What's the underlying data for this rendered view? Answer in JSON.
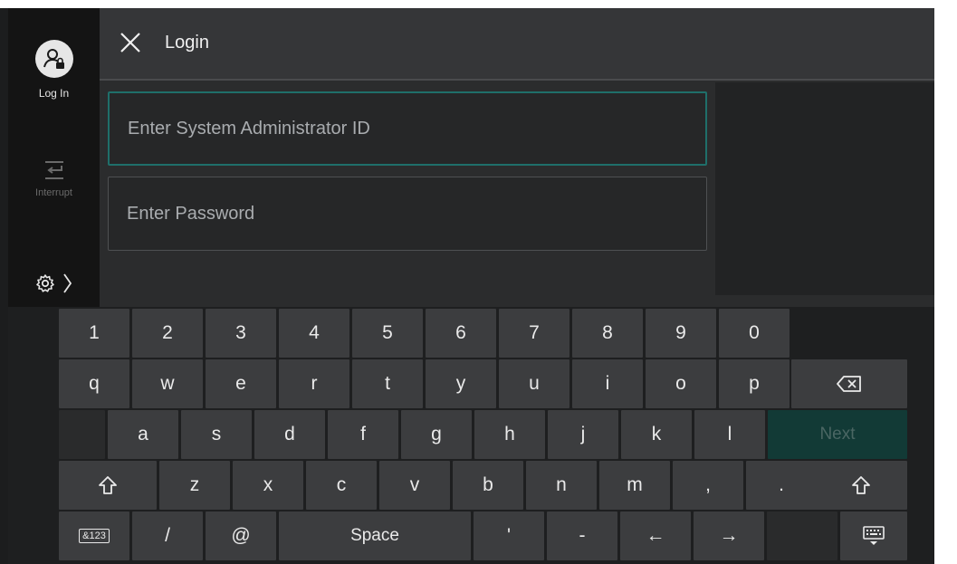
{
  "header": {
    "title": "Login"
  },
  "sidebar": {
    "login_label": "Log In",
    "interrupt_label": "Interrupt"
  },
  "fields": {
    "id_placeholder": "Enter System Administrator ID",
    "password_placeholder": "Enter Password"
  },
  "keyboard": {
    "row_numbers": [
      "1",
      "2",
      "3",
      "4",
      "5",
      "6",
      "7",
      "8",
      "9",
      "0"
    ],
    "row_q": [
      "q",
      "w",
      "e",
      "r",
      "t",
      "y",
      "u",
      "i",
      "o",
      "p"
    ],
    "row_a": [
      "a",
      "s",
      "d",
      "f",
      "g",
      "h",
      "j",
      "k",
      "l"
    ],
    "row_z": [
      "z",
      "x",
      "c",
      "v",
      "b",
      "n",
      "m",
      ",",
      "."
    ],
    "next_label": "Next",
    "mode_label": "&123",
    "slash": "/",
    "at": "@",
    "space_label": "Space",
    "apostrophe": "'",
    "dash": "-",
    "left_arrow": "←",
    "right_arrow": "→"
  },
  "colors": {
    "accent": "#1f6f6a",
    "next_bg": "#123a36"
  }
}
